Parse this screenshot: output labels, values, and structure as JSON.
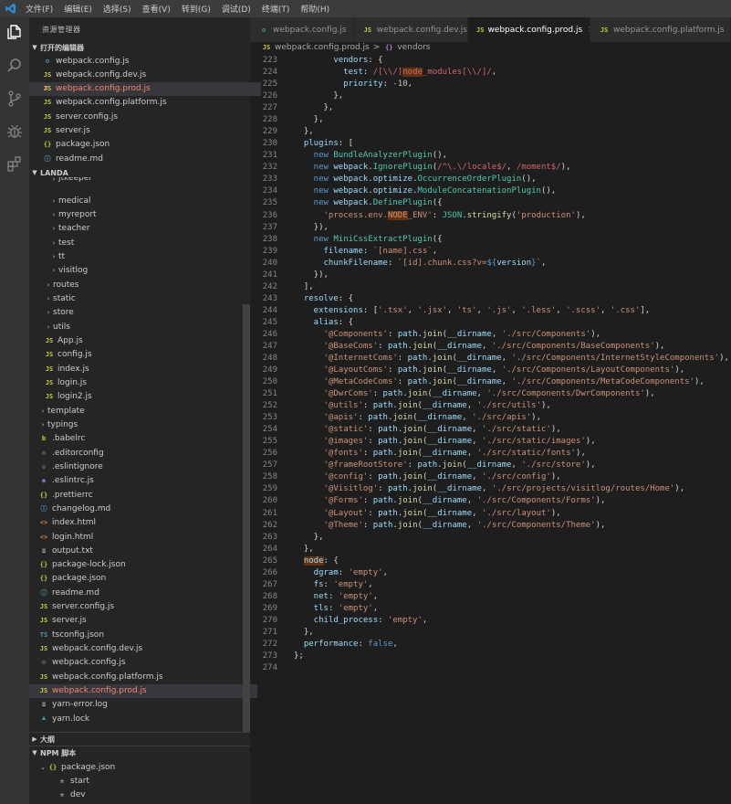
{
  "menu": [
    "文件(F)",
    "编辑(E)",
    "选择(S)",
    "查看(V)",
    "转到(G)",
    "调试(D)",
    "终端(T)",
    "帮助(H)"
  ],
  "sidebar": {
    "title": "资源管理器",
    "open_editors_header": "打开的编辑器",
    "open_editors": [
      {
        "icon": "gear-file-icon",
        "label": "webpack.config.js"
      },
      {
        "icon": "js-icon",
        "label": "webpack.config.dev.js"
      },
      {
        "icon": "js-icon",
        "label": "webpack.config.prod.js",
        "active": true
      },
      {
        "icon": "js-icon",
        "label": "webpack.config.platform.js"
      },
      {
        "icon": "js-icon",
        "label": "server.config.js"
      },
      {
        "icon": "js-icon",
        "label": "server.js"
      },
      {
        "icon": "json-icon",
        "label": "package.json"
      },
      {
        "icon": "info-icon",
        "label": "readme.md"
      }
    ],
    "project_header": "LANDA",
    "tree": [
      {
        "label": "jtkeeper",
        "type": "folder",
        "depth": 3,
        "partial": true
      },
      {
        "label": "medical",
        "type": "folder",
        "depth": 3
      },
      {
        "label": "myreport",
        "type": "folder",
        "depth": 3
      },
      {
        "label": "teacher",
        "type": "folder",
        "depth": 3
      },
      {
        "label": "test",
        "type": "folder",
        "depth": 3
      },
      {
        "label": "tt",
        "type": "folder",
        "depth": 3
      },
      {
        "label": "visitlog",
        "type": "folder",
        "depth": 3
      },
      {
        "label": "routes",
        "type": "folder",
        "depth": 2
      },
      {
        "label": "static",
        "type": "folder",
        "depth": 2
      },
      {
        "label": "store",
        "type": "folder",
        "depth": 2
      },
      {
        "label": "utils",
        "type": "folder",
        "depth": 2
      },
      {
        "label": "App.js",
        "type": "js",
        "depth": 2
      },
      {
        "label": "config.js",
        "type": "js",
        "depth": 2
      },
      {
        "label": "index.js",
        "type": "js",
        "depth": 2
      },
      {
        "label": "login.js",
        "type": "js",
        "depth": 2
      },
      {
        "label": "login2.js",
        "type": "js",
        "depth": 2
      },
      {
        "label": "template",
        "type": "folder",
        "depth": 1
      },
      {
        "label": "typings",
        "type": "folder",
        "depth": 1
      },
      {
        "label": ".babelrc",
        "type": "babel",
        "depth": 1
      },
      {
        "label": ".editorconfig",
        "type": "gear",
        "depth": 1
      },
      {
        "label": ".eslintignore",
        "type": "eslint",
        "depth": 1
      },
      {
        "label": ".eslintrc.js",
        "type": "eslint2",
        "depth": 1
      },
      {
        "label": ".prettierrc",
        "type": "json",
        "depth": 1
      },
      {
        "label": "changelog.md",
        "type": "info",
        "depth": 1
      },
      {
        "label": "index.html",
        "type": "html",
        "depth": 1
      },
      {
        "label": "login.html",
        "type": "html",
        "depth": 1
      },
      {
        "label": "output.txt",
        "type": "txt",
        "depth": 1
      },
      {
        "label": "package-lock.json",
        "type": "json",
        "depth": 1
      },
      {
        "label": "package.json",
        "type": "json",
        "depth": 1
      },
      {
        "label": "readme.md",
        "type": "info",
        "depth": 1
      },
      {
        "label": "server.config.js",
        "type": "js",
        "depth": 1
      },
      {
        "label": "server.js",
        "type": "js",
        "depth": 1
      },
      {
        "label": "tsconfig.json",
        "type": "ts",
        "depth": 1
      },
      {
        "label": "webpack.config.dev.js",
        "type": "js",
        "depth": 1
      },
      {
        "label": "webpack.config.js",
        "type": "gear",
        "depth": 1
      },
      {
        "label": "webpack.config.platform.js",
        "type": "js",
        "depth": 1
      },
      {
        "label": "webpack.config.prod.js",
        "type": "js",
        "depth": 1,
        "active": true
      },
      {
        "label": "yarn-error.log",
        "type": "txt",
        "depth": 1
      },
      {
        "label": "yarn.lock",
        "type": "yarn",
        "depth": 1
      }
    ],
    "outline_header": "大纲",
    "npm_header": "NPM 脚本",
    "npm": {
      "file": "package.json",
      "scripts": [
        "start",
        "dev"
      ]
    }
  },
  "tabs": [
    {
      "icon": "gear-file-icon",
      "label": "webpack.config.js"
    },
    {
      "icon": "js-icon",
      "label": "webpack.config.dev.js"
    },
    {
      "icon": "js-icon",
      "label": "webpack.config.prod.js",
      "active": true
    },
    {
      "icon": "js-icon",
      "label": "webpack.config.platform.js"
    }
  ],
  "breadcrumb": {
    "file": "webpack.config.prod.js",
    "separator": ">",
    "symbol": "vendors"
  },
  "code_start_line": 223,
  "code_lines": [
    [
      8,
      [
        [
          "p",
          "vendors"
        ],
        [
          "",
          "{"
        ]
      ],
      ""
    ],
    [
      10,
      [],
      "x"
    ]
  ]
}
